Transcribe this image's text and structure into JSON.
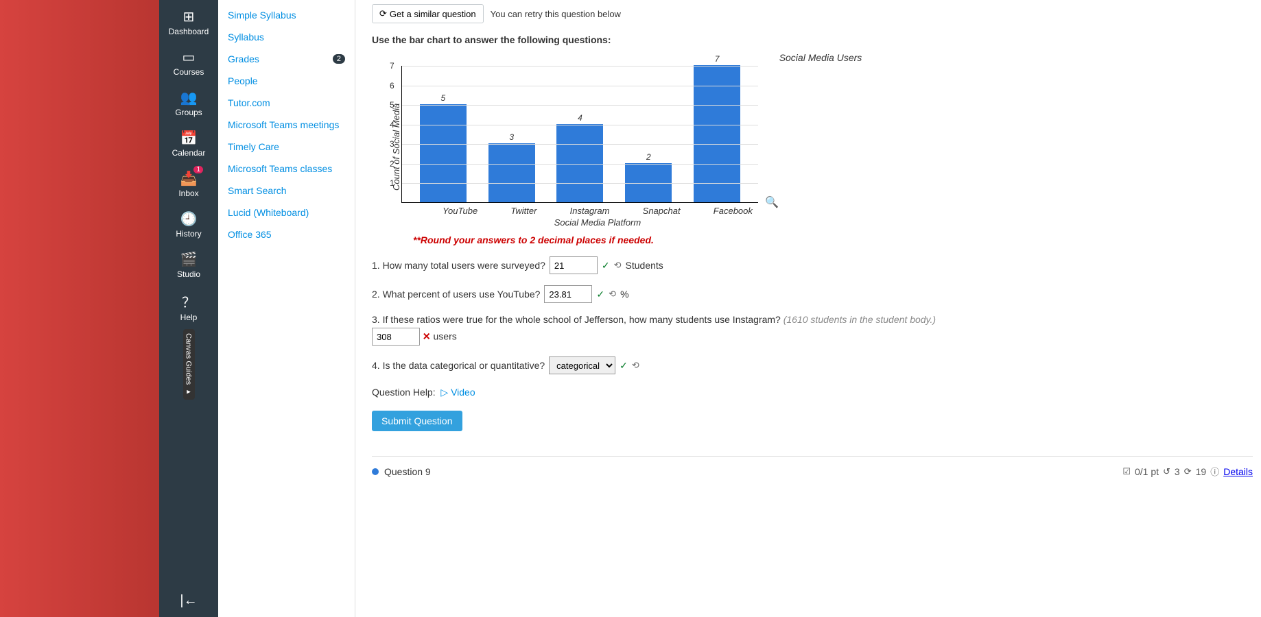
{
  "rail": {
    "dashboard": "Dashboard",
    "courses": "Courses",
    "groups": "Groups",
    "calendar": "Calendar",
    "inbox": "Inbox",
    "inbox_badge": "1",
    "history": "History",
    "studio": "Studio",
    "help": "Help",
    "guides": "Canvas Guides ▸"
  },
  "courseNav": {
    "items": [
      "Simple Syllabus",
      "Syllabus",
      "Grades",
      "People",
      "Tutor.com",
      "Microsoft Teams meetings",
      "Timely Care",
      "Microsoft Teams classes",
      "Smart Search",
      "Lucid (Whiteboard)",
      "Office 365"
    ],
    "grades_badge": "2"
  },
  "topbar": {
    "similar": "Get a similar question",
    "retry": "You can retry this question below"
  },
  "prompt": "Use the bar chart to answer the following questions:",
  "chart_data": {
    "type": "bar",
    "title": "Social Media Users",
    "xlabel": "Social Media Platform",
    "ylabel": "Count of Social Media",
    "categories": [
      "YouTube",
      "Twitter",
      "Instagram",
      "Snapchat",
      "Facebook"
    ],
    "values": [
      5,
      3,
      4,
      2,
      7
    ],
    "ylim": [
      0,
      7
    ],
    "ticks": [
      1,
      2,
      3,
      4,
      5,
      6,
      7
    ]
  },
  "note": "**Round your answers to 2 decimal places if needed.",
  "q1": {
    "text": "1. How many total users were surveyed?",
    "value": "21",
    "unit": "Students"
  },
  "q2": {
    "text": "2. What percent of users use YouTube?",
    "value": "23.81",
    "unit": "%"
  },
  "q3": {
    "text": "3. If these ratios were true for the whole school of Jefferson, how many students use Instagram?",
    "hint": "(1610 students in the student body.)",
    "value": "308",
    "unit": "users"
  },
  "q4": {
    "text": "4. Is the data categorical or quantitative?",
    "value": "categorical"
  },
  "help": {
    "label": "Question Help:",
    "video": "Video"
  },
  "submit": "Submit Question",
  "footer": {
    "qnum": "Question 9",
    "score": "0/1 pt",
    "retries": "3",
    "attempts": "19",
    "details": "Details"
  }
}
